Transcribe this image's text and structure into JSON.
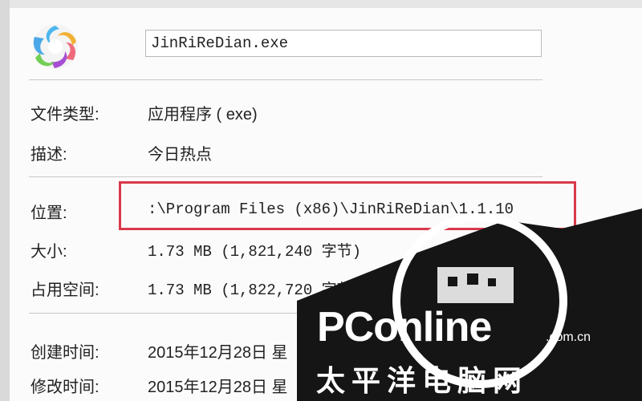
{
  "file": {
    "name": "JinRiReDian.exe"
  },
  "properties": {
    "type_label": "文件类型:",
    "type_value": "应用程序 ( exe)",
    "description_label": "描述:",
    "description_value": "今日热点",
    "location_label": "位置:",
    "location_value": ":\\Program Files (x86)\\JinRiReDian\\1.1.10",
    "size_label": "大小:",
    "size_value": "1.73 MB (1,821,240 字节)",
    "size_on_disk_label": "占用空间:",
    "size_on_disk_value": "1.73 MB (1,822,720 字节)",
    "created_label": "创建时间:",
    "created_value": "2015年12月28日",
    "created_suffix": "星",
    "modified_label": "修改时间:",
    "modified_value": "2015年12月28日",
    "modified_suffix": "星"
  },
  "watermark": {
    "brand": "PConline",
    "domain": ".com.cn",
    "chinese": "太平洋电脑网"
  },
  "colors": {
    "highlight_border": "#d9394a",
    "watermark_dark": "#151515"
  },
  "icons": {
    "app": "swirl-app-icon"
  }
}
